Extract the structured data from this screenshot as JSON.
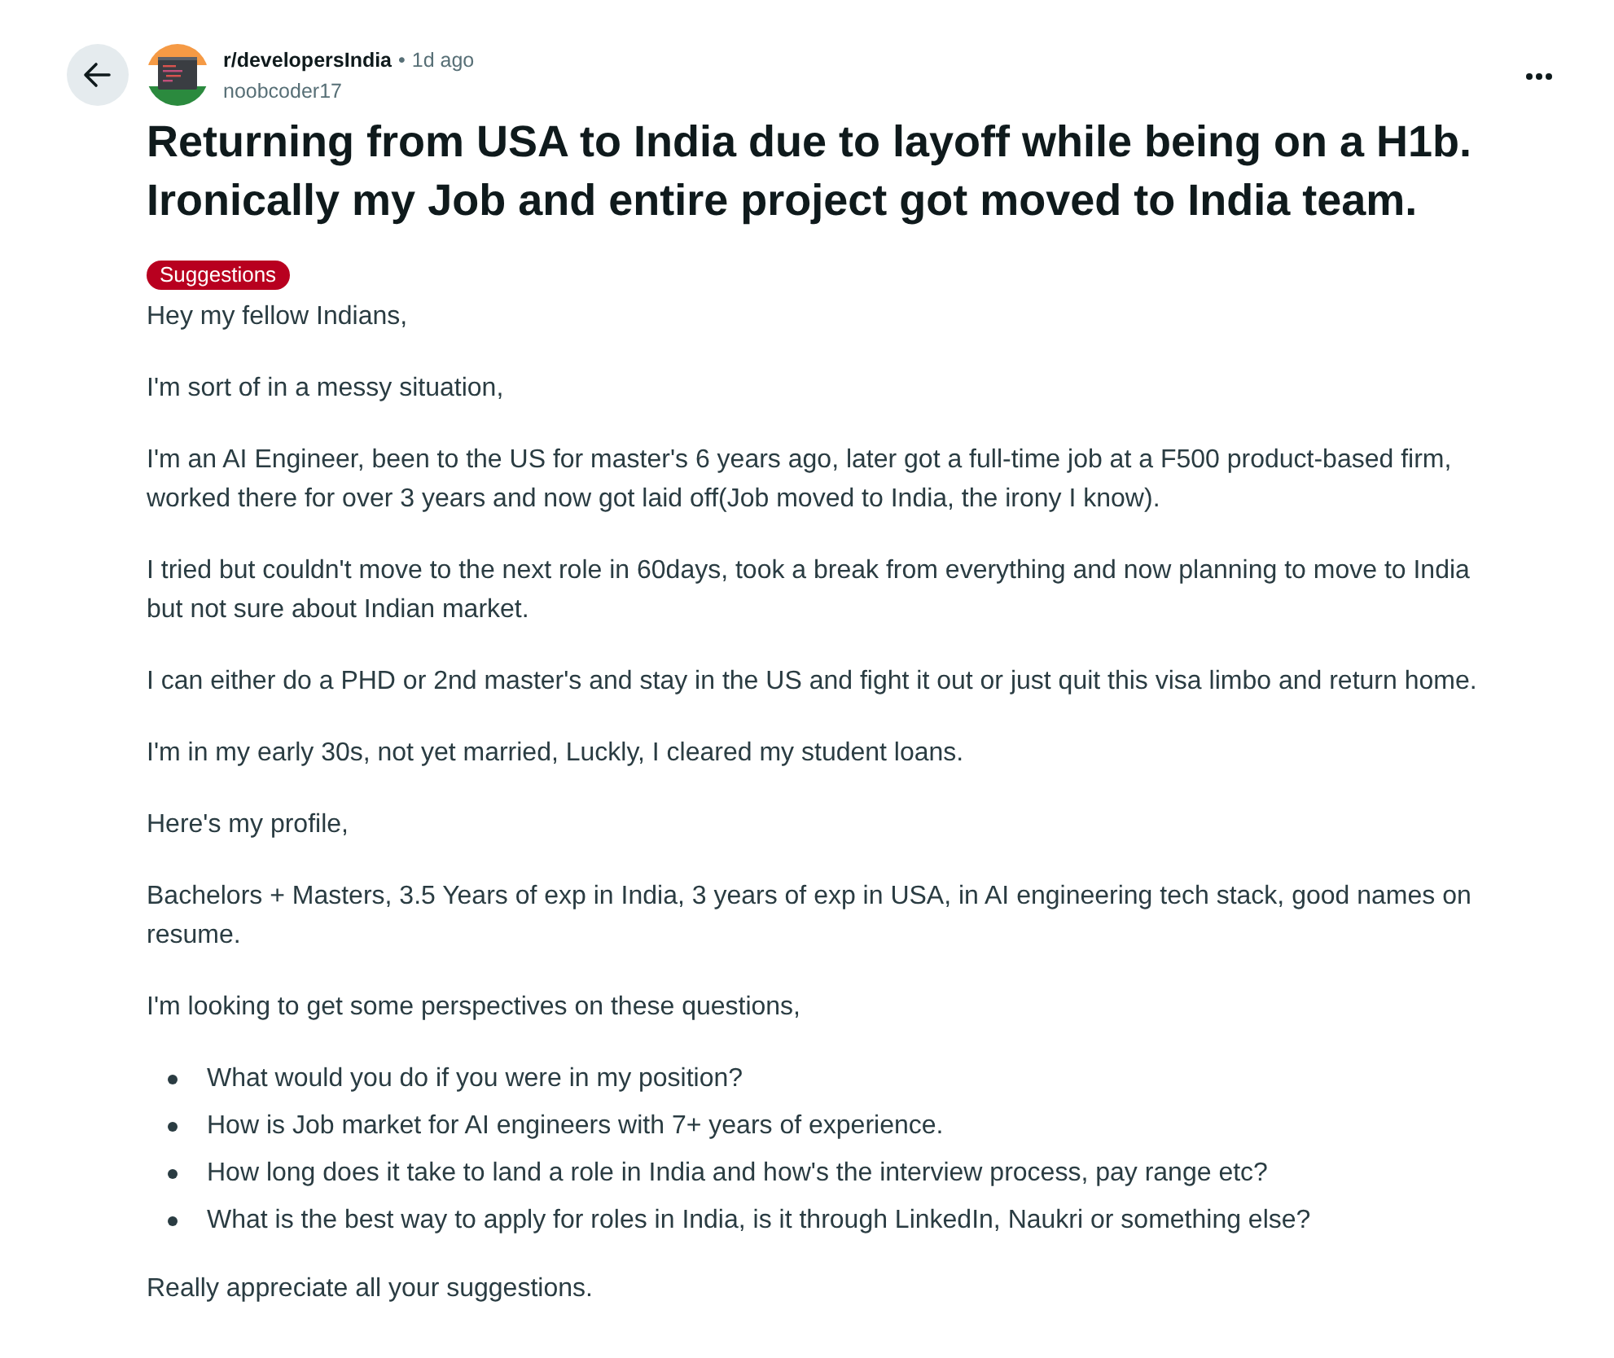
{
  "header": {
    "subreddit": "r/developersIndia",
    "separator": "•",
    "time": "1d ago",
    "author": "noobcoder17"
  },
  "post": {
    "title": "Returning from USA to India due to layoff while being on a H1b. Ironically my Job and entire project got moved to India team.",
    "flair": "Suggestions"
  },
  "body": [
    {
      "kind": "paragraph",
      "text": "Hey my fellow Indians,"
    },
    {
      "kind": "paragraph",
      "text": "I'm sort of in a messy situation,"
    },
    {
      "kind": "paragraph",
      "text": "I'm an AI Engineer, been to the US for master's 6 years ago, later got a full-time job at a F500 product-based firm, worked there for over 3 years and now got laid off(Job moved to India, the irony I know)."
    },
    {
      "kind": "paragraph",
      "text": "I tried but couldn't move to the next role in 60days, took a break from everything and now planning to move to India but not sure about Indian market."
    },
    {
      "kind": "paragraph",
      "text": "I can either do a PHD or 2nd master's and stay in the US and fight it out or just quit this visa limbo and return home."
    },
    {
      "kind": "paragraph",
      "text": "I'm in my early 30s, not yet married, Luckly, I cleared my student loans."
    },
    {
      "kind": "paragraph",
      "text": "Here's my profile,"
    },
    {
      "kind": "paragraph",
      "text": "Bachelors + Masters, 3.5 Years of exp in India, 3 years of exp in USA, in AI engineering tech stack, good names on resume."
    },
    {
      "kind": "paragraph",
      "text": "I'm looking to get some perspectives on these questions,"
    },
    {
      "kind": "list",
      "items": [
        "What would you do if you were in my position?",
        "How is Job market for AI engineers with 7+ years of experience.",
        "How long does it take to land a role in India and how's the interview process, pay range etc?",
        "What is the best way to apply for roles in India, is it through LinkedIn, Naukri or something else?"
      ]
    },
    {
      "kind": "paragraph",
      "text": "Really appreciate all your suggestions."
    }
  ]
}
